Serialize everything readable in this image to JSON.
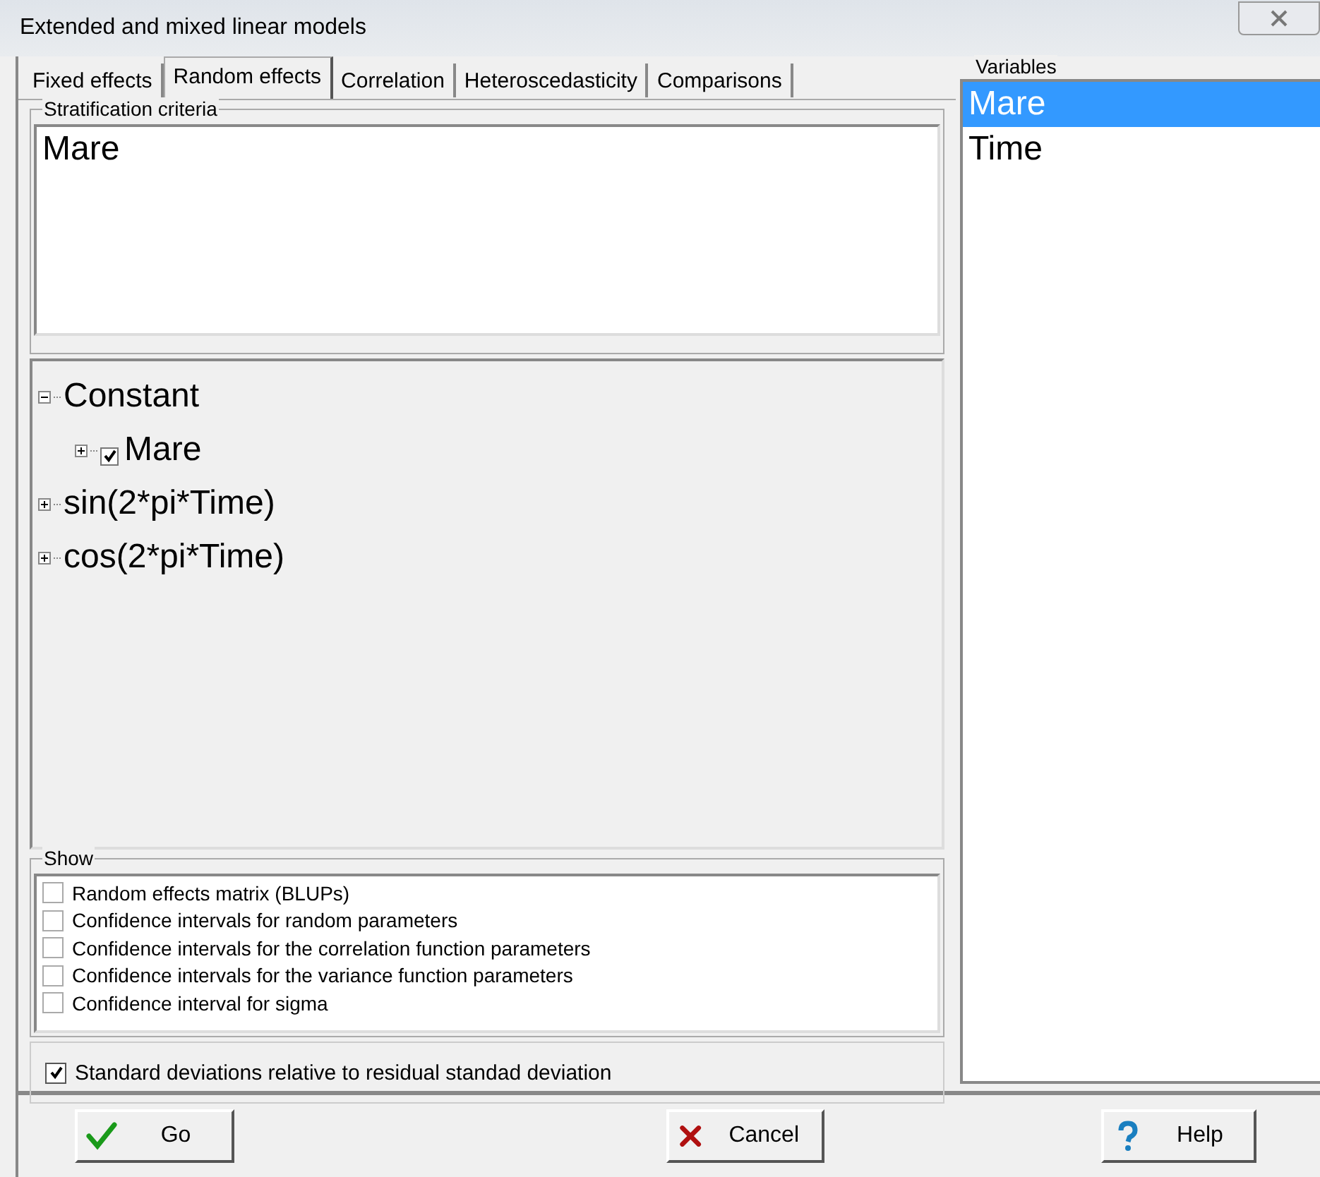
{
  "window": {
    "title": "Extended and mixed linear models"
  },
  "tabs": [
    {
      "label": "Fixed effects",
      "selected": false
    },
    {
      "label": "Random effects",
      "selected": true
    },
    {
      "label": "Correlation",
      "selected": false
    },
    {
      "label": "Heteroscedasticity",
      "selected": false
    },
    {
      "label": "Comparisons",
      "selected": false
    }
  ],
  "stratification": {
    "label": "Stratification criteria",
    "items": [
      "Mare"
    ]
  },
  "tree": [
    {
      "label": "Constant",
      "expanded": true,
      "children": [
        {
          "label": "Mare",
          "expanded": false,
          "checked": true
        }
      ]
    },
    {
      "label": "sin(2*pi*Time)",
      "expanded": false
    },
    {
      "label": "cos(2*pi*Time)",
      "expanded": false
    }
  ],
  "show": {
    "label": "Show",
    "options": [
      {
        "label": "Random effects matrix (BLUPs)",
        "checked": false
      },
      {
        "label": "Confidence intervals for random parameters",
        "checked": false
      },
      {
        "label": "Confidence intervals for the correlation function parameters",
        "checked": false
      },
      {
        "label": "Confidence intervals for the variance function parameters",
        "checked": false
      },
      {
        "label": "Confidence interval for sigma",
        "checked": false
      }
    ]
  },
  "relative_sd": {
    "label": "Standard deviations relative to residual standad deviation",
    "checked": true
  },
  "variables": {
    "label": "Variables",
    "items": [
      {
        "label": "Mare",
        "selected": true
      },
      {
        "label": "Time",
        "selected": false
      }
    ]
  },
  "buttons": [
    {
      "kind": "go",
      "label": "Go"
    },
    {
      "kind": "cancel",
      "label": "Cancel"
    },
    {
      "kind": "help",
      "label": "Help"
    }
  ]
}
